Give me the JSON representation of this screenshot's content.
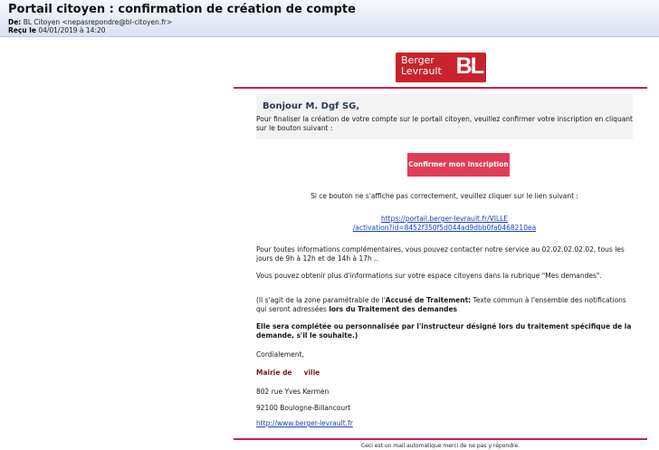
{
  "header": {
    "subject": "Portail citoyen : confirmation de création de compte",
    "from_label": "De:",
    "from_value": "BL Citoyen <nepasrepondre@bl-citoyen.fr>",
    "date_label": "Reçu le",
    "date_value": "04/01/2019 à 14:20"
  },
  "logo": {
    "line1": "Berger",
    "line2": "Levrault",
    "mark": "BL"
  },
  "email": {
    "greeting": "Bonjour M. Dgf SG,",
    "intro": "Pour finaliser la création de votre compte sur le portail citoyen, veuillez confirmer votre inscription en cliquant sur le bouton suivant :",
    "button_label": "Confirmer mon inscription",
    "fallback": "Si ce bouton ne s'affiche pas correctement, veuillez cliquer sur le lien suivant :",
    "link_line1": "https://portail.berger-levrault.fr/VILLE",
    "link_line2": "/activation?id=8452f350f5d044ad9dbb0fa0468210ea",
    "para_contact": "Pour toutes informations complémentaires, vous pouvez contacter notre service au 02.02.02.02.02, tous les jours de 9h à 12h et de 14h à 17h ..",
    "para_space": "Vous pouvez obtenir plus d'informations sur votre espace citoyens dans la rubrique \"Mes demandes\".",
    "para_note_a": "(Il s'agit de la zone paramétrable de l'",
    "para_note_b": "Accusé de Traitement:",
    "para_note_c": " Texte commun à l'ensemble des notifications qui seront adressées ",
    "para_note_d": "lors du Traitement des demandes",
    "para_bold": "Elle sera complétée ou personnalisée par l'instructeur désigné lors du traitement spécifique de la demande, s'il le souhaite.)",
    "regards": "Cordialement,",
    "sig_city": "Mairie de     ville",
    "sig_addr1": "802 rue Yves Kermen",
    "sig_addr2": "92100 Boulogne-Billancourt",
    "sig_url": "http://www.berger-levrault.fr"
  },
  "footer": "Ceci est un mail automatique merci de ne pas y répondre."
}
